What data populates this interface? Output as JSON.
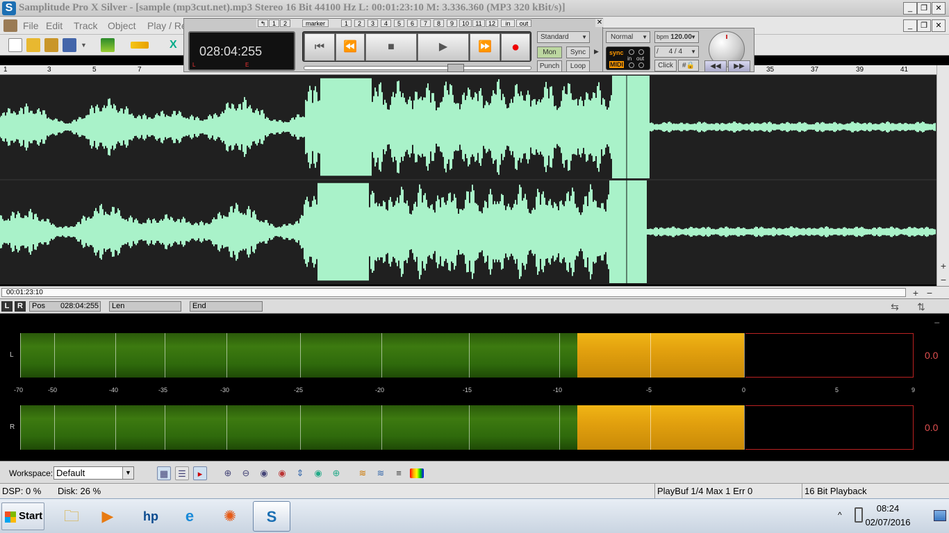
{
  "window": {
    "title": "Samplitude Pro X Silver - [sample (mp3cut.net).mp3  Stereo 16 Bit 44100 Hz L: 00:01:23:10 M: 3.336.360  (MP3 320 kBit/s)]",
    "app_icon": "S"
  },
  "menu": [
    "File",
    "Edit",
    "Track",
    "Object",
    "Play / Re"
  ],
  "transport": {
    "time_display": "028:04:255",
    "lcd_l": "L",
    "lcd_e": "E",
    "marker_label": "marker",
    "marker_numbers": [
      "1",
      "2",
      "1",
      "2",
      "3",
      "4",
      "5",
      "6",
      "7",
      "8",
      "9",
      "10",
      "11",
      "12"
    ],
    "in_label": "in",
    "out_label": "out",
    "mode": "Standard",
    "mon": "Mon",
    "sync": "Sync",
    "punch": "Punch",
    "loop": "Loop",
    "normal": "Normal",
    "bpm_label": "bpm",
    "bpm_value": "120.00",
    "signature_sep": "/",
    "signature": "4 / 4",
    "click": "Click",
    "sync_label": "sync",
    "midi_label": "MIDI",
    "in_small": "in",
    "out_small": "out"
  },
  "ruler": [
    "1",
    "3",
    "5",
    "7",
    "35",
    "37",
    "39",
    "41"
  ],
  "scroll": {
    "position_label": "00:01:23:10"
  },
  "position_row": {
    "L": "L",
    "R": "R",
    "pos_label": "Pos",
    "pos_value": "028:04:255",
    "len_label": "Len",
    "end_label": "End"
  },
  "meter": {
    "channels": [
      "L",
      "R"
    ],
    "peak_values": [
      "0.0",
      "0.0"
    ],
    "scale": [
      "-70",
      "-50",
      "-40",
      "-35",
      "-30",
      "-25",
      "-20",
      "-15",
      "-10",
      "-5",
      "0",
      "5",
      "9"
    ],
    "level_db": -9,
    "green_color": "#3d7a10",
    "yellow_color": "#e2a00e"
  },
  "workspace": {
    "label": "Workspace:",
    "value": "Default"
  },
  "status": {
    "dsp": "DSP: 0 %",
    "disk": "Disk: 26 %",
    "playbuf": "PlayBuf 1/4  Max 1  Err 0",
    "playback": "16 Bit Playback"
  },
  "taskbar": {
    "start": "Start",
    "time": "08:24",
    "date": "02/07/2016",
    "tray_expand": "^"
  },
  "colors": {
    "waveform": "#a9f2c9",
    "waveform_bg": "#202020"
  }
}
